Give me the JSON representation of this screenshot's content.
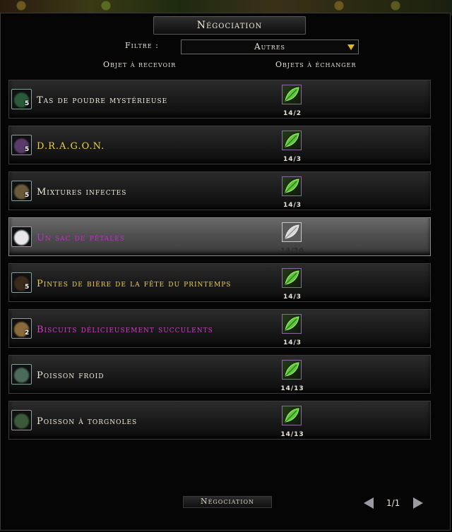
{
  "window": {
    "title": "Négociation"
  },
  "filter": {
    "label": "Filtre :",
    "value": "Autres"
  },
  "columns": {
    "receive": "Objet à recevoir",
    "exchange": "Objets à échanger"
  },
  "items": [
    {
      "name": "Tas de poudre mystérieuse",
      "qty": "5",
      "count": "14/2",
      "color": "#f0ead8",
      "icon_color": "#2a5a3a",
      "icon": "powder-pile-icon"
    },
    {
      "name": "D.R.A.G.O.N.",
      "qty": "5",
      "count": "14/3",
      "color": "#f0d040",
      "icon_color": "#5a3a6a",
      "icon": "potion-icon"
    },
    {
      "name": "Mixtures infectes",
      "qty": "5",
      "count": "14/3",
      "color": "#f0ead8",
      "icon_color": "#6a5a3a",
      "icon": "mixture-icon"
    },
    {
      "name": "Un sac de pétales",
      "qty": "",
      "count": "14/20",
      "color": "#c030c0",
      "icon_color": "#e8e8e8",
      "icon": "petal-bag-icon"
    },
    {
      "name": "Pintes de bière de la fête du printemps",
      "qty": "5",
      "count": "14/3",
      "color": "#f0d040",
      "icon_color": "#3a2a1a",
      "icon": "beer-pint-icon"
    },
    {
      "name": "Biscuits délicieusement succulents",
      "qty": "2",
      "count": "14/3",
      "color": "#d040c8",
      "icon_color": "#8a6a3a",
      "icon": "biscuit-icon"
    },
    {
      "name": "Poisson froid",
      "qty": "",
      "count": "14/13",
      "color": "#f0ead8",
      "icon_color": "#4a6a5a",
      "icon": "fish-icon"
    },
    {
      "name": "Poisson à torgnoles",
      "qty": "",
      "count": "14/13",
      "color": "#f0ead8",
      "icon_color": "#3a5a3a",
      "icon": "fish-icon"
    }
  ],
  "selected_index": 3,
  "footer": {
    "button": "Négociation",
    "page": "1/1"
  }
}
